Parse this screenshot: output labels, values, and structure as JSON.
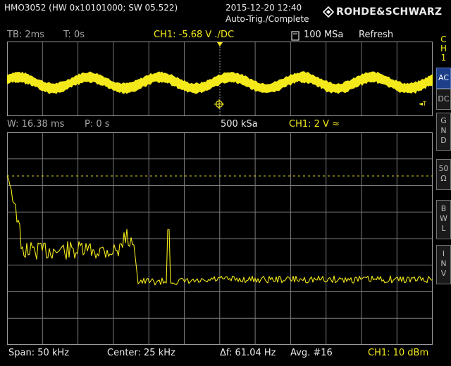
{
  "header": {
    "device": "HMO3052 (HW 0x10101000; SW 05.522)",
    "datetime": "2015-12-20 12:40",
    "trigger_status": "Auto-Trig./Complete",
    "brand": "ROHDE&SCHWARZ"
  },
  "top_bar": {
    "timebase": "TB: 2ms",
    "t_offset": "T: 0s",
    "ch1_trigger": "CH1: -5.68 V ./DC",
    "sample_rate": "100 MSa",
    "mode": "Refresh"
  },
  "mid_bar": {
    "window": "W: 16.38 ms",
    "position": "P: 0 s",
    "sample_rate": "500 kSa",
    "ch1_scale": "CH1: 2 V ≈"
  },
  "bottom_bar": {
    "span": "Span: 50 kHz",
    "center": "Center: 25 kHz",
    "delta_f": "Δf: 61.04 Hz",
    "average": "Avg. #16",
    "ch1_ref": "CH1: 10 dBm"
  },
  "side_menu": {
    "channel_label": [
      "C",
      "H",
      "1"
    ],
    "keys": [
      {
        "label": "AC",
        "active": true
      },
      {
        "label": "DC",
        "active": false
      },
      {
        "label": "G\nN\nD",
        "active": false
      },
      {
        "label": "50\nΩ",
        "active": false
      },
      {
        "label": "B\nW\nL",
        "active": false
      },
      {
        "label": "I\nN\nV",
        "active": false
      }
    ]
  },
  "overview_marker": "T",
  "fft_marker": "1",
  "colors": {
    "trace": "#f4ea1b",
    "grid": "#9a9a9a",
    "active_key": "#1d3f8a"
  }
}
